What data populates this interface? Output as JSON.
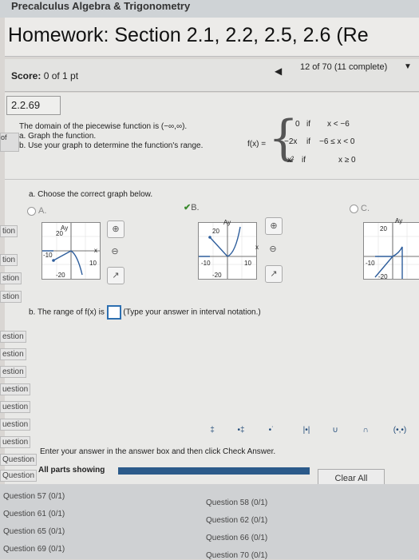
{
  "course": {
    "title": "Precalculus Algebra & Trigonometry"
  },
  "header": {
    "title": "Homework: Section 2.1, 2.2, 2.5, 2.6 (Re"
  },
  "score": {
    "label": "Score:",
    "value": "0 of 1 pt"
  },
  "nav": {
    "progress": "12 of 70 (11 complete)",
    "prev_icon": "◀",
    "next_icon": "▼"
  },
  "question": {
    "number": "2.2.69",
    "intro": "The domain of the piecewise function is (−∞,∞).",
    "part_a_text": "a. Graph the function.",
    "part_b_text": "b. Use your graph to determine the function's range.",
    "fx_label": "f(x) =",
    "pieces": [
      {
        "expr": "0",
        "cond_if": "if",
        "cond": "x < −6"
      },
      {
        "expr": "−2x",
        "cond_if": "if",
        "cond": "−6 ≤ x < 0"
      },
      {
        "expr": "x²",
        "cond_if": "if",
        "cond": "x ≥ 0"
      }
    ]
  },
  "part_a": {
    "prompt": "a. Choose the correct graph below.",
    "options": [
      {
        "label": "A."
      },
      {
        "label": "B."
      },
      {
        "label": "C."
      }
    ],
    "axis_labels": {
      "y": "Ay",
      "x": "x",
      "top": "20",
      "bottom": "-20",
      "left": "-10",
      "right": "10"
    }
  },
  "part_b": {
    "prompt_prefix": "b. The range of f(x) is",
    "prompt_suffix": "(Type your answer in interval notation.)"
  },
  "palette": {
    "buttons": [
      "‡",
      "•‡",
      "•˙",
      "|•|",
      "∪",
      "∩",
      "(•,•)"
    ]
  },
  "footer": {
    "instructions": "Enter your answer in the answer box and then click Check Answer.",
    "parts_showing": "All parts showing",
    "clear_all": "Clear All"
  },
  "left_rail": [
    "tion",
    "tion",
    "stion",
    "stion",
    "estion",
    "estion",
    "estion",
    "uestion",
    "uestion",
    "uestion",
    "uestion",
    "Question",
    "Question"
  ],
  "question_list": [
    {
      "label": "Question 57 (0/1)"
    },
    {
      "label": "Question 58 (0/1)"
    },
    {
      "label": "Question 61 (0/1)"
    },
    {
      "label": "Question 62 (0/1)"
    },
    {
      "label": "Question 65 (0/1)"
    },
    {
      "label": "Question 66 (0/1)"
    },
    {
      "label": "Question 69 (0/1)"
    },
    {
      "label": "Question 70 (0/1)"
    }
  ]
}
